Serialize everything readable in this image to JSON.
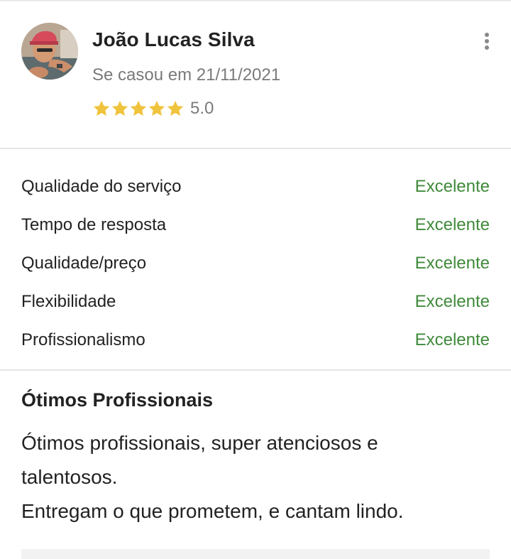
{
  "review": {
    "author_name": "João Lucas Silva",
    "married_text": "Se casou em 21/11/2021",
    "stars": 5,
    "score": "5.0",
    "star_color": "#f0c33c"
  },
  "categories": [
    {
      "label": "Qualidade do serviço",
      "value": "Excelente"
    },
    {
      "label": "Tempo de resposta",
      "value": "Excelente"
    },
    {
      "label": "Qualidade/preço",
      "value": "Excelente"
    },
    {
      "label": "Flexibilidade",
      "value": "Excelente"
    },
    {
      "label": "Profissionalismo",
      "value": "Excelente"
    }
  ],
  "content": {
    "title": "Ótimos Profissionais",
    "line1": "Ótimos profissionais, super atenciosos e talentosos.",
    "line2": "Entregam o que prometem, e cantam lindo."
  },
  "colors": {
    "accent_green": "#3f8a3a",
    "muted_text": "#7a7a7a"
  },
  "icons": {
    "menu": "kebab-vertical-icon",
    "star": "star-icon"
  }
}
